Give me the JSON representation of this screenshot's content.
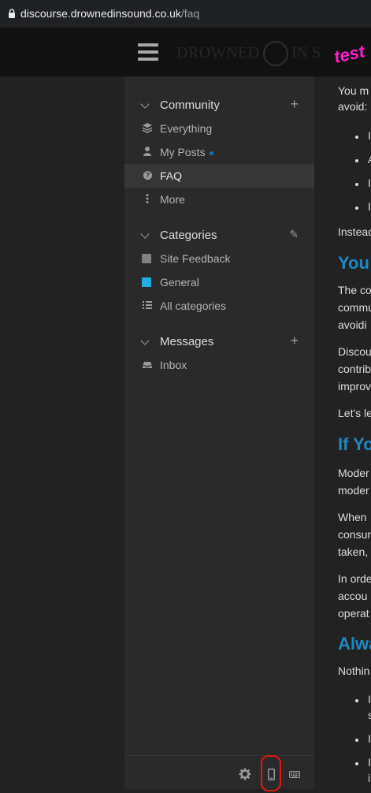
{
  "browser": {
    "url_host": "discourse.drownedinsound.co.uk",
    "url_path": "/faq"
  },
  "header": {
    "logo_text_left": "DROWNED",
    "logo_text_right": "IN S",
    "badge": "test",
    "menu_icon": "hamburger-icon"
  },
  "sidebar": {
    "community": {
      "title": "Community",
      "action": "+",
      "items": [
        {
          "label": "Everything",
          "icon": "layers-icon"
        },
        {
          "label": "My Posts",
          "icon": "user-icon"
        },
        {
          "label": "FAQ",
          "icon": "question-circle-icon"
        },
        {
          "label": "More",
          "icon": "ellipsis-vertical-icon"
        }
      ]
    },
    "categories": {
      "title": "Categories",
      "action": "✎",
      "items": [
        {
          "label": "Site Feedback",
          "color": "#808281"
        },
        {
          "label": "General",
          "color": "#25aae2"
        },
        {
          "label": "All categories",
          "icon": "list-icon"
        }
      ]
    },
    "messages": {
      "title": "Messages",
      "action": "+",
      "items": [
        {
          "label": "Inbox",
          "icon": "inbox-icon"
        }
      ]
    },
    "footer": {
      "icons": [
        "gear-icon",
        "mobile-icon",
        "keyboard-icon"
      ]
    }
  },
  "content": {
    "lines": [
      "You m",
      "avoid:",
      "I",
      "A",
      "I",
      "I",
      "Instead",
      "The co",
      "commu",
      "avoidi",
      "Discou",
      "contrib",
      "improv",
      "Let's le",
      "Moder",
      "moder",
      "When",
      "consur",
      "taken,",
      "In orde",
      "accou",
      "operat",
      "Nothin",
      "I",
      "s",
      "I",
      "I",
      "i"
    ],
    "headings": [
      "You",
      "If Yo",
      "Alwa"
    ]
  }
}
